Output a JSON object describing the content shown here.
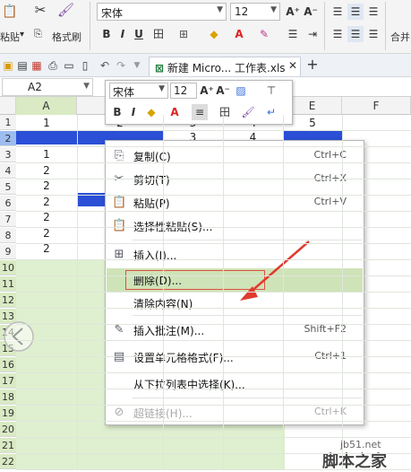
{
  "ribbon": {
    "paste_label": "粘贴",
    "format_painter_label": "格式刷",
    "font_name": "宋体",
    "font_size": "12",
    "merge_label": "合并",
    "grow_font": "A⁺",
    "shrink_font": "A⁻",
    "bold": "B",
    "italic": "I",
    "underline": "U"
  },
  "tabs": {
    "document_tab": "新建 Micro... 工作表.xls",
    "add_tab": "+"
  },
  "formula_bar": {
    "name_box": "A2"
  },
  "mini_toolbar": {
    "font_name": "宋体",
    "font_size": "12",
    "bold": "B",
    "italic": "I",
    "grow_font": "A⁺",
    "shrink_font": "A⁻"
  },
  "sheet": {
    "columns": [
      "A",
      "B",
      "C",
      "D",
      "E",
      "F"
    ],
    "rows": [
      "1",
      "2",
      "3",
      "4",
      "5",
      "6",
      "7",
      "8",
      "9",
      "10",
      "11",
      "12",
      "13",
      "14",
      "15",
      "16",
      "17",
      "18",
      "19",
      "20",
      "21",
      "22"
    ],
    "row1": [
      "1",
      "2",
      "3",
      "4",
      "5"
    ],
    "row2": [
      "",
      "",
      "3",
      "4",
      ""
    ],
    "colA_values": [
      "1",
      "2",
      "2",
      "2",
      "2",
      "2",
      "2"
    ],
    "selection_color": "#2b4fd6",
    "grid_fill": "#dff0d0"
  },
  "context_menu": {
    "items": [
      {
        "label": "复制(C)",
        "shortcut": "Ctrl+C",
        "icon": "copy-icon"
      },
      {
        "label": "剪切(T)",
        "shortcut": "Ctrl+X",
        "icon": "cut-icon"
      },
      {
        "label": "粘贴(P)",
        "shortcut": "Ctrl+V",
        "icon": "paste-icon"
      },
      {
        "label": "选择性粘贴(S)...",
        "shortcut": "",
        "icon": "paste-special-icon"
      },
      {
        "label": "插入(I)...",
        "shortcut": "",
        "icon": "insert-icon"
      },
      {
        "label": "删除(D)...",
        "shortcut": "",
        "icon": ""
      },
      {
        "label": "清除内容(N)",
        "shortcut": "",
        "icon": ""
      },
      {
        "label": "插入批注(M)...",
        "shortcut": "Shift+F2",
        "icon": "comment-icon"
      },
      {
        "label": "设置单元格格式(F)...",
        "shortcut": "Ctrl+1",
        "icon": "format-cells-icon"
      },
      {
        "label": "从下拉列表中选择(K)...",
        "shortcut": "",
        "icon": ""
      },
      {
        "label": "超链接(H)...",
        "shortcut": "Ctrl+K",
        "icon": "hyperlink-icon"
      }
    ],
    "highlight_color": "#cfe3b8",
    "annotation_box_color": "#e05040",
    "arrow_color": "#e03b2f"
  },
  "watermark": {
    "site": "jb51.net",
    "brand": "脚本之家"
  }
}
